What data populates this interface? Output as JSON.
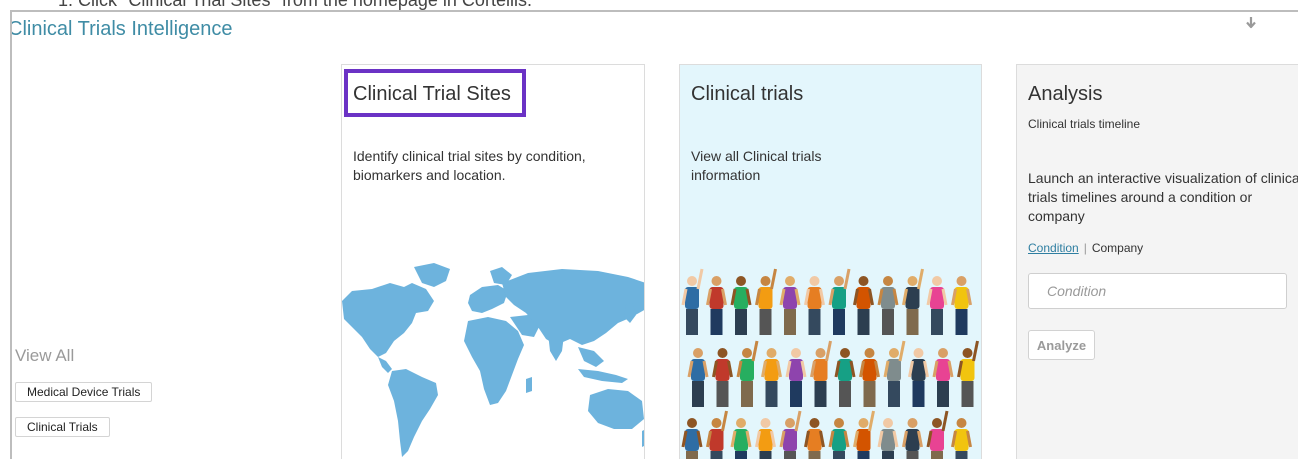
{
  "instruction": "1.  Click \"Clinical Trial Sites\" from the homepage in Cortellis.",
  "app": {
    "title": "Clinical Trials Intelligence"
  },
  "sidebar": {
    "view_all_label": "View All",
    "buttons": [
      {
        "label": "Medical Device Trials"
      },
      {
        "label": "Clinical Trials"
      }
    ]
  },
  "cards": {
    "sites": {
      "title": "Clinical Trial Sites",
      "description_line1": "Identify clinical trial sites by condition,",
      "description_line2": "biomarkers and location.",
      "image": "world-map"
    },
    "trials": {
      "title": "Clinical trials",
      "description_line1": "View all Clinical trials",
      "description_line2": "information",
      "image": "crowd-of-people"
    },
    "analysis": {
      "title": "Analysis",
      "subtitle": "Clinical trials timeline",
      "description": "Launch an interactive visualization of clinical trials timelines around a condition or company",
      "links": {
        "condition": "Condition",
        "separator": "|",
        "company": "Company"
      },
      "input_placeholder": "Condition",
      "analyze_label": "Analyze"
    }
  },
  "colors": {
    "accent": "#3f8ca5",
    "highlight": "#6b32c5",
    "trials_bg": "#e3f6fc",
    "map_fill": "#6db3dd"
  },
  "icons": {
    "collapse": "arrow-down-icon"
  }
}
